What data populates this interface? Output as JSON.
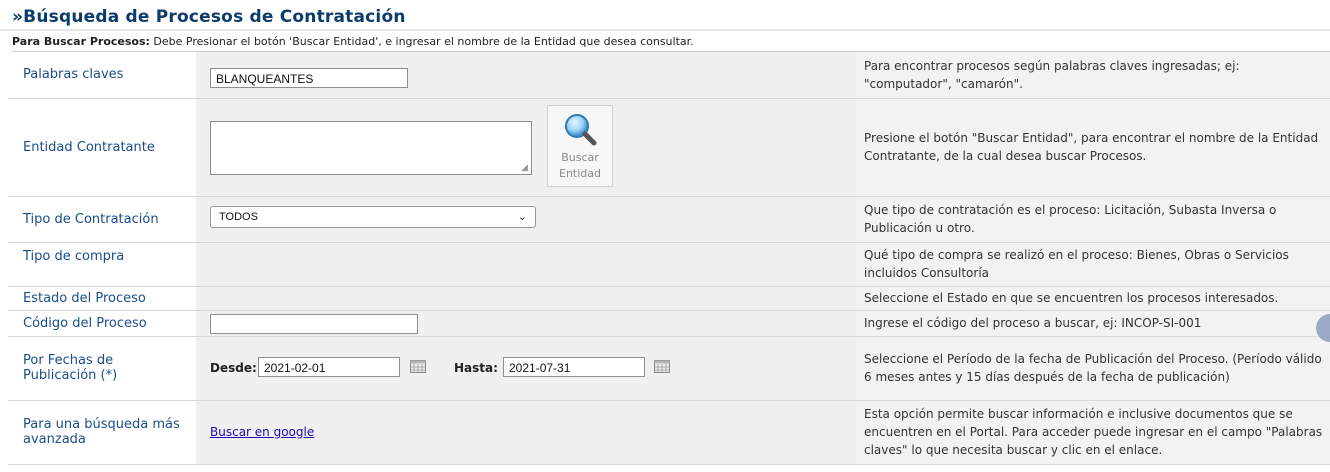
{
  "page": {
    "title": "»Búsqueda de Procesos de Contratación",
    "hint_bold": "Para Buscar Procesos:",
    "hint_text": " Debe Presionar el botón 'Buscar Entidad', e ingresar el nombre de la Entidad que desea consultar."
  },
  "rows": {
    "keywords": {
      "label": "Palabras claves",
      "value": "BLANQUEANTES",
      "help": "Para encontrar procesos según palabras claves ingresadas; ej: \"computador\", \"camarón\"."
    },
    "entity": {
      "label": "Entidad Contratante",
      "value": "",
      "button_line1": "Buscar",
      "button_line2": "Entidad",
      "help": "Presione el botón \"Buscar Entidad\", para encontrar el nombre de la Entidad Contratante, de la cual desea buscar Procesos."
    },
    "contract_type": {
      "label": "Tipo de Contratación",
      "selected": "TODOS",
      "help": "Que tipo de contratación es el proceso: Licitación, Subasta Inversa o Publicación u otro."
    },
    "purchase_type": {
      "label": "Tipo de compra",
      "help": "Qué tipo de compra se realizó en el proceso: Bienes, Obras o Servicios incluidos Consultoría"
    },
    "status": {
      "label": "Estado del Proceso",
      "help": "Seleccione el Estado en que se encuentren los procesos interesados."
    },
    "code": {
      "label": "Código del Proceso",
      "value": "",
      "help": "Ingrese el código del proceso a buscar, ej: INCOP-SI-001"
    },
    "dates": {
      "label": "Por Fechas de Publicación (*)",
      "from_label": "Desde:",
      "from_value": "2021-02-01",
      "to_label": "Hasta:",
      "to_value": "2021-07-31",
      "help": "Seleccione el Período de la fecha de Publicación del Proceso. (Período válido 6 meses antes y 15 días después de la fecha de publicación)"
    },
    "advanced": {
      "label": "Para una búsqueda más avanzada",
      "link": "Buscar en google",
      "help": "Esta opción permite buscar información e inclusive documentos que se encuentren en el Portal. Para acceder puede ingresar en el campo \"Palabras claves\" lo que necesita buscar y clic en el enlace."
    }
  },
  "icons": {
    "search": "magnifier-icon",
    "calendar": "calendar-icon",
    "dropdown": "chevron-down-icon"
  }
}
